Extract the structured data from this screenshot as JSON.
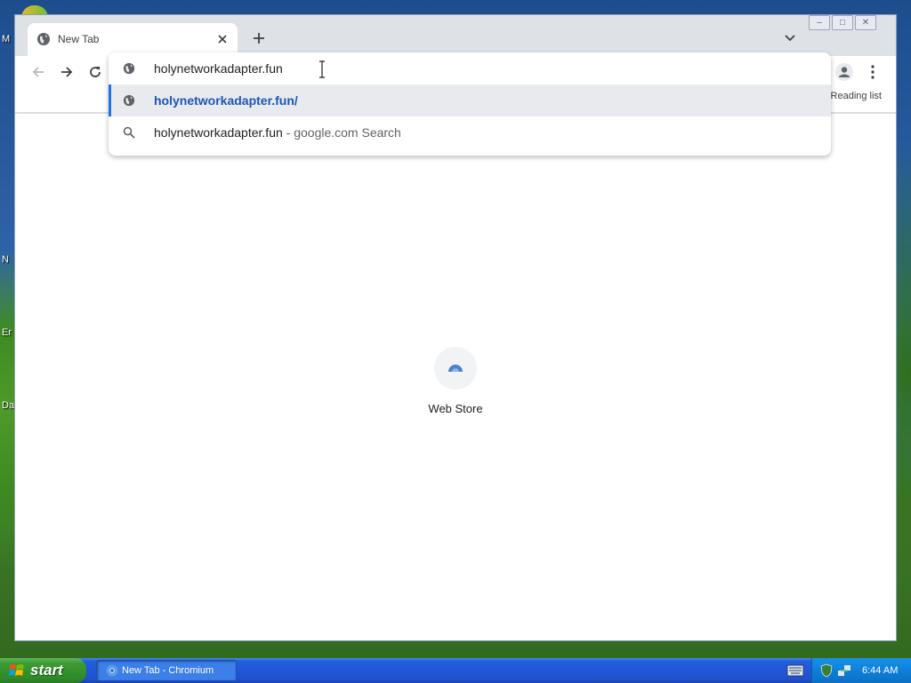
{
  "desktop": {
    "labels": [
      "M",
      "N",
      "Er",
      "Da"
    ]
  },
  "window": {
    "tab": {
      "title": "New Tab"
    },
    "controls": {
      "minimize": "–",
      "maximize": "□",
      "close": "✕"
    }
  },
  "omnibox": {
    "value": "holynetworkadapter.fun",
    "suggestions": [
      {
        "text": "holynetworkadapter.fun/",
        "type": "url",
        "icon": "globe-icon",
        "selected": true
      },
      {
        "text": "holynetworkadapter.fun",
        "sep": " - ",
        "engine": "google.com Search",
        "type": "search",
        "icon": "search-icon",
        "selected": false
      }
    ]
  },
  "bookmarks": {
    "reading_list": "Reading list"
  },
  "content": {
    "shortcut_label": "Web Store"
  },
  "taskbar": {
    "start_label": "start",
    "task_label": "New Tab - Chromium",
    "clock": "6:44 AM"
  },
  "colors": {
    "accent": "#1a73e8",
    "url_text": "#1a56b8",
    "taskbar": "#245edb",
    "start": "#3c9c34"
  }
}
